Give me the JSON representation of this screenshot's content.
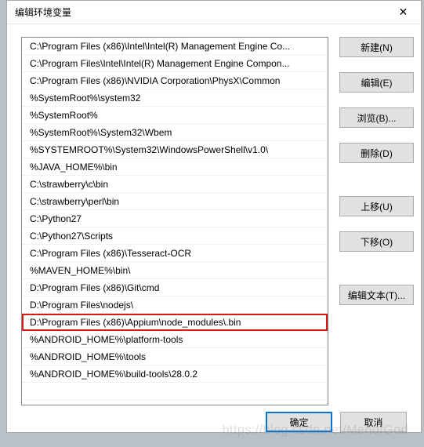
{
  "title": "编辑环境变量",
  "list_items": [
    {
      "text": "C:\\Program Files (x86)\\Intel\\Intel(R) Management Engine Co...",
      "highlighted": false
    },
    {
      "text": "C:\\Program Files\\Intel\\Intel(R) Management Engine Compon...",
      "highlighted": false
    },
    {
      "text": "C:\\Program Files (x86)\\NVIDIA Corporation\\PhysX\\Common",
      "highlighted": false
    },
    {
      "text": "%SystemRoot%\\system32",
      "highlighted": false
    },
    {
      "text": "%SystemRoot%",
      "highlighted": false
    },
    {
      "text": "%SystemRoot%\\System32\\Wbem",
      "highlighted": false
    },
    {
      "text": "%SYSTEMROOT%\\System32\\WindowsPowerShell\\v1.0\\",
      "highlighted": false
    },
    {
      "text": "%JAVA_HOME%\\bin",
      "highlighted": false
    },
    {
      "text": "C:\\strawberry\\c\\bin",
      "highlighted": false
    },
    {
      "text": "C:\\strawberry\\perl\\bin",
      "highlighted": false
    },
    {
      "text": "C:\\Python27",
      "highlighted": false
    },
    {
      "text": "C:\\Python27\\Scripts",
      "highlighted": false
    },
    {
      "text": "C:\\Program Files (x86)\\Tesseract-OCR",
      "highlighted": false
    },
    {
      "text": "%MAVEN_HOME%\\bin\\",
      "highlighted": false
    },
    {
      "text": "D:\\Program Files (x86)\\Git\\cmd",
      "highlighted": false
    },
    {
      "text": "D:\\Program Files\\nodejs\\",
      "highlighted": false
    },
    {
      "text": "D:\\Program Files (x86)\\Appium\\node_modules\\.bin",
      "highlighted": true
    },
    {
      "text": "%ANDROID_HOME%\\platform-tools",
      "highlighted": false
    },
    {
      "text": "%ANDROID_HOME%\\tools",
      "highlighted": false
    },
    {
      "text": "%ANDROID_HOME%\\build-tools\\28.0.2",
      "highlighted": false
    },
    {
      "text": "",
      "highlighted": false
    }
  ],
  "buttons": {
    "new": "新建(N)",
    "edit": "编辑(E)",
    "browse": "浏览(B)...",
    "delete": "删除(D)",
    "move_up": "上移(U)",
    "move_down": "下移(O)",
    "edit_text": "编辑文本(T)..."
  },
  "footer": {
    "ok": "确定",
    "cancel": "取消"
  },
  "watermark": "https://blog.csdn.net/MenofGod"
}
